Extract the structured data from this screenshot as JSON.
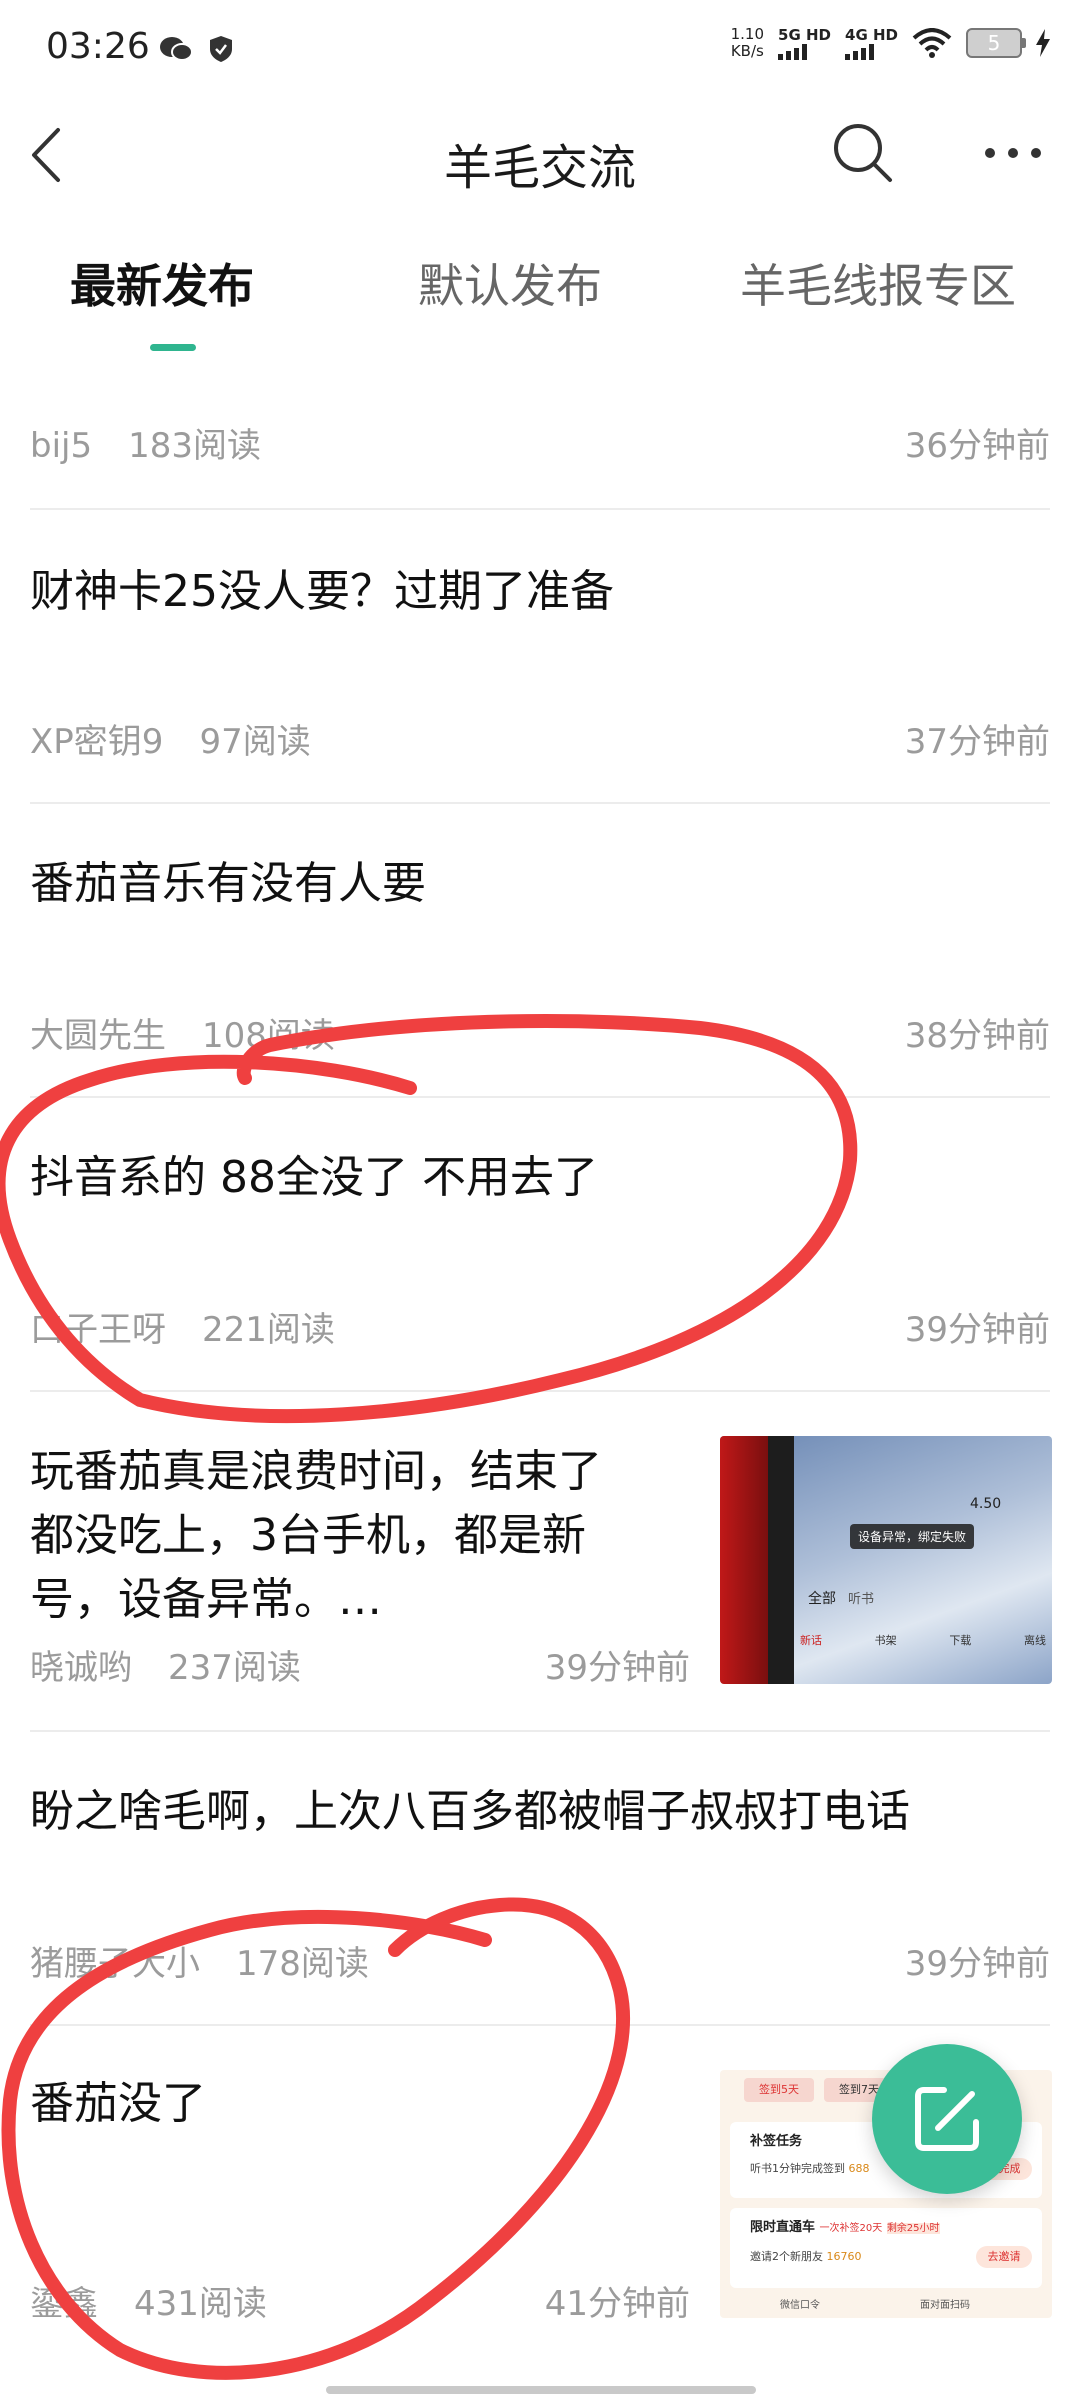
{
  "status_bar": {
    "time": "03:26",
    "net_speed_value": "1.10",
    "net_speed_unit": "KB/s",
    "sim1": "5G HD",
    "sim2": "4G HD",
    "battery": "5"
  },
  "header": {
    "title": "羊毛交流",
    "icons": [
      "back-icon",
      "search-icon",
      "more-icon"
    ]
  },
  "tabs": [
    {
      "label": "最新发布",
      "active": true
    },
    {
      "label": "默认发布",
      "active": false
    },
    {
      "label": "羊毛线报专区",
      "active": false
    }
  ],
  "posts": [
    {
      "title": "",
      "author": "bij5",
      "reads": "183阅读",
      "time": "36分钟前"
    },
    {
      "title": "财神卡25没人要？过期了准备",
      "author": "XP密钥9",
      "reads": "97阅读",
      "time": "37分钟前"
    },
    {
      "title": "番茄音乐有没有人要",
      "author": "大圆先生",
      "reads": "108阅读",
      "time": "38分钟前"
    },
    {
      "title": "抖音系的 88全没了 不用去了",
      "author": "口子王呀",
      "reads": "221阅读",
      "time": "39分钟前"
    },
    {
      "title_lines": [
        "玩番茄真是浪费时间，结束了",
        "都没吃上，3台手机，都是新",
        "号，设备异常。…"
      ],
      "author": "晓诚哟",
      "reads": "237阅读",
      "time": "39分钟前",
      "thumbnail": {
        "caption": "设备异常，绑定失败",
        "tab_all": "全部",
        "tab_listen": "听书",
        "value": "4.50",
        "labels": [
          "新话",
          "书架",
          "下载",
          "离线"
        ]
      }
    },
    {
      "title": "盼之啥毛啊，上次八百多都被帽子叔叔打电话",
      "author": "猪腰子大小",
      "reads": "178阅读",
      "time": "39分钟前"
    },
    {
      "title": "番茄没了",
      "author": "鎏鑫",
      "reads": "431阅读",
      "time": "41分钟前",
      "thumbnail": {
        "task_title": "补签任务",
        "task_desc": "听书1分钟完成签到",
        "task_coins": "688",
        "task_button": "去完成",
        "limited_title": "限时直通车",
        "limited_note": "一次补签20天",
        "limited_tag": "剩余25小时",
        "invite": "邀请2个新朋友",
        "invite_coins": "16760",
        "invite_button": "去邀请",
        "footer_left": "微信口令",
        "footer_right": "面对面扫码",
        "day_left": "签到5天",
        "day_right": "签到7天"
      }
    }
  ],
  "colors": {
    "accent": "#3bbd97",
    "annotation": "#ef4040"
  }
}
